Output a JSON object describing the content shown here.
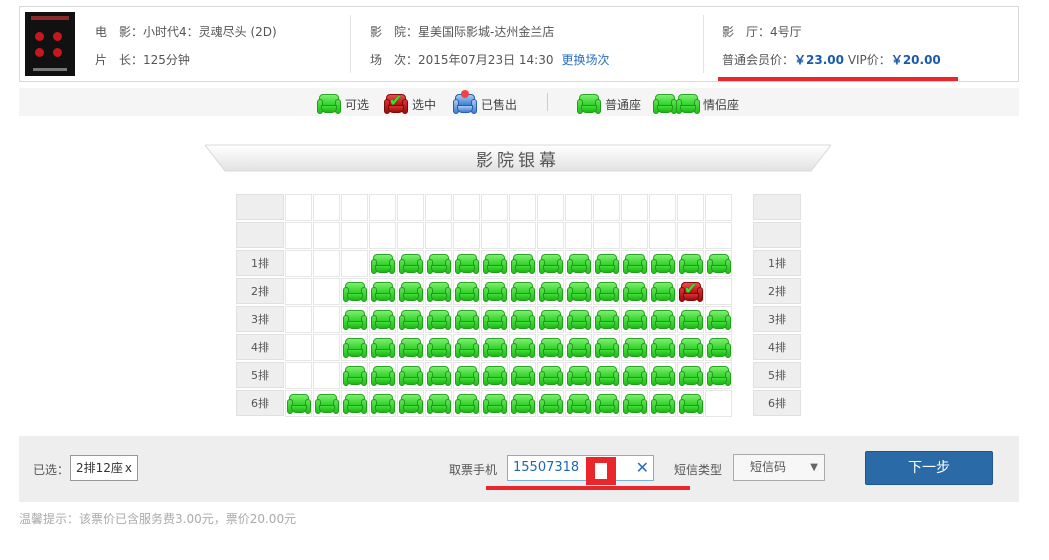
{
  "movie": {
    "title_label": "电　影：",
    "title": "小时代4：灵魂尽头 (2D)",
    "length_label": "片　长：",
    "length": "125分钟"
  },
  "cinema": {
    "name_label": "影　院：",
    "name": "星美国际影城-达州金兰店",
    "session_label": "场　次：",
    "session": "2015年07月23日 14:30",
    "change_link": "更换场次"
  },
  "hall": {
    "hall_label": "影　厅：",
    "hall": "4号厅",
    "price_label": "普通会员价：",
    "price": "￥23.00",
    "vip_label": "VIP价：",
    "vip_price": "￥20.00"
  },
  "legend": {
    "available": "可选",
    "selected": "选中",
    "sold": "已售出",
    "normal": "普通座",
    "couple": "情侣座"
  },
  "screen_label": "影院银幕",
  "rows": [
    "",
    "",
    "1排",
    "2排",
    "3排",
    "4排",
    "5排",
    "6排"
  ],
  "seat_map": {
    "columns": 16,
    "rows": [
      {
        "label": "",
        "seats": ""
      },
      {
        "label": "",
        "seats": ""
      },
      {
        "label": "1排",
        "seats": "...AAAAAAAAAAAAA"
      },
      {
        "label": "2排",
        "seats": "..AAAAAAAAAAAAS.."
      },
      {
        "label": "3排",
        "seats": "..AAAAAAAAAAAAAA"
      },
      {
        "label": "4排",
        "seats": "..AAAAAAAAAAAAAA"
      },
      {
        "label": "5排",
        "seats": "..AAAAAAAAAAAAAA"
      },
      {
        "label": "6排",
        "seats": "AAAAAAAAAAAAAAA"
      }
    ]
  },
  "bottom": {
    "chosen_label": "已选：",
    "chosen_value": "2排12座",
    "chosen_remove": "x",
    "phone_label": "取票手机",
    "phone_value": "15507318",
    "phone_clear": "✕",
    "sms_label": "短信类型",
    "sms_value": "短信码",
    "sms_arrow": "▼",
    "next_button": "下一步"
  },
  "tip": "温馨提示：该票价已含服务费3.00元，票价20.00元",
  "colors": {
    "accent_blue": "#2a6aa6",
    "price_blue": "#1a5aa8",
    "highlight_red": "#e8262b",
    "seat_green": "#2fcf2a",
    "seat_red": "#b51010"
  }
}
